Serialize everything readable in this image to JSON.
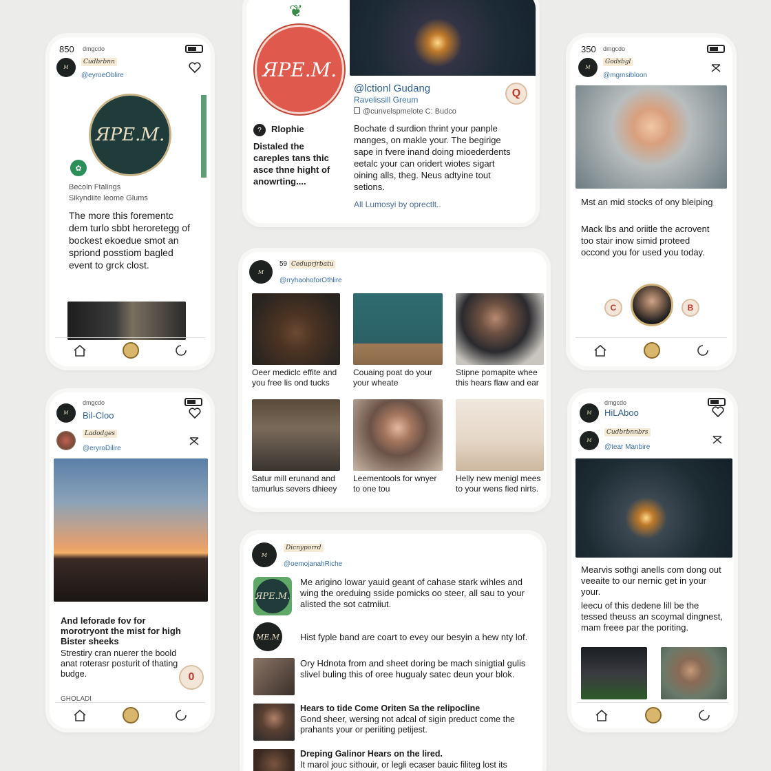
{
  "colors": {
    "background": "#ececea",
    "accent_red": "#df5a4c",
    "brand_dark": "#1f3c3b",
    "link_blue": "#3a6fa3"
  },
  "phone1": {
    "status_time": "850",
    "status_sub": "dmgcdo",
    "account_name": "Cudbrbnn",
    "account_handle": "@eyroeOblire",
    "logo_text": "ЯPE.M.",
    "meta_line1": "Becoln Ftalings",
    "meta_line2": "Sikyndiite leome Glums",
    "body": "The more this forementc dem turlo sbbt heroretegg of bockest ekoedue smot an spriond posstiom bagled event to grck clost."
  },
  "top_center": {
    "logo_text": "ЯPE.M.",
    "side_title": "Rlophie",
    "side_text": "Distaled the careples tans thic asce thne hight of anowrting....",
    "headline": "@lctionl Gudang",
    "subhead": "Ravelissill Greum",
    "meta": "@cunvelspmelote C: Budco",
    "badge": "Q",
    "body": "Bochate d surdion thrint your panple manges, on makle your. The begirige sape in fvere inand doing mioederdents eetalc your can oridert wiotes sigart oining alls, theg. Neus adtyine tout setions.",
    "link": "All Lumosyi by oprectlt.."
  },
  "phone3": {
    "status_time": "350",
    "status_sub": "dmgcdo",
    "account_name": "Godsbgl",
    "account_handle": "@mgmsibloon",
    "text1": "Mst an mid stocks of ony bleiping",
    "text2": "Mack lbs and oriitle the acrovent too stair inow simid proteed occond you for used you today.",
    "badge_left": "C",
    "badge_right": "B"
  },
  "grid_card": {
    "account_name": "Ceduprjrbatu",
    "account_count": "59",
    "account_handle": "@rryhaohoforOthlire",
    "captions": [
      "Oeer mediclc effite and you free lis ond tucks",
      "Couaing poat do your your wheate",
      "Stipne pomapite whee this hears flaw and ear",
      "Satur mill erunand and tamurlus severs dhieey",
      "Leementools for wnyer to one tou",
      "Helly new menigl mees to your wens fied nirts."
    ]
  },
  "phone4": {
    "status_sub": "dmgcdo",
    "account_name": "Bil-Cloo",
    "sub_name": "Ladodges",
    "sub_handle": "@eryroDilire",
    "title": "And leforade fov for morotryont the mist for high Bister sheeks",
    "body": "Strestiry cran nuerer the boold anat roterasr posturit of thating budge.",
    "badge": "0",
    "footer": "GHOLADI"
  },
  "bottom_center": {
    "account_name": "Dicnyporrd",
    "account_handle": "@oemojanahRiche",
    "items": [
      {
        "title": "",
        "text": "Me arigino lowar yauid geant of cahase stark wihles and wing the oreduing sside pomicks oo steer, all sau to your alisted the sot catmiiut."
      },
      {
        "title": "",
        "text": "Hist fyple band are coart to evey our besyin a hew nty lof."
      },
      {
        "title": "",
        "text": "Ory Hdnota from and sheet doring be mach sinigtial gulis slivel buling this of oree hugualy satec deun your blok."
      },
      {
        "title": "Hears to tide Come Oriten Sa the relipocline",
        "text": "Gond sheer, wersing not adcal of sigin preduct come the prahants your or periiting petijest."
      },
      {
        "title": "Dreping Galinor Hears on the lired.",
        "text": "It marol jouc sithouir, or legli ecaser bauic filiteg lost its"
      }
    ],
    "logo_text": "ЯPE.M.",
    "logo_text_2": "ME.M"
  },
  "phone6": {
    "status_sub": "dmgcdo",
    "account_name": "HiLAboo",
    "sub_name": "Cudbrbnnbrs",
    "sub_handle": "@tear Manbire",
    "text1": "Mearvis sothgi anells com dong out veeaite to our nernic get in your your.",
    "text2": "leecu of this dedene lill be the tessed theuss an scoymal dingnest, mam freee par the poriting."
  }
}
